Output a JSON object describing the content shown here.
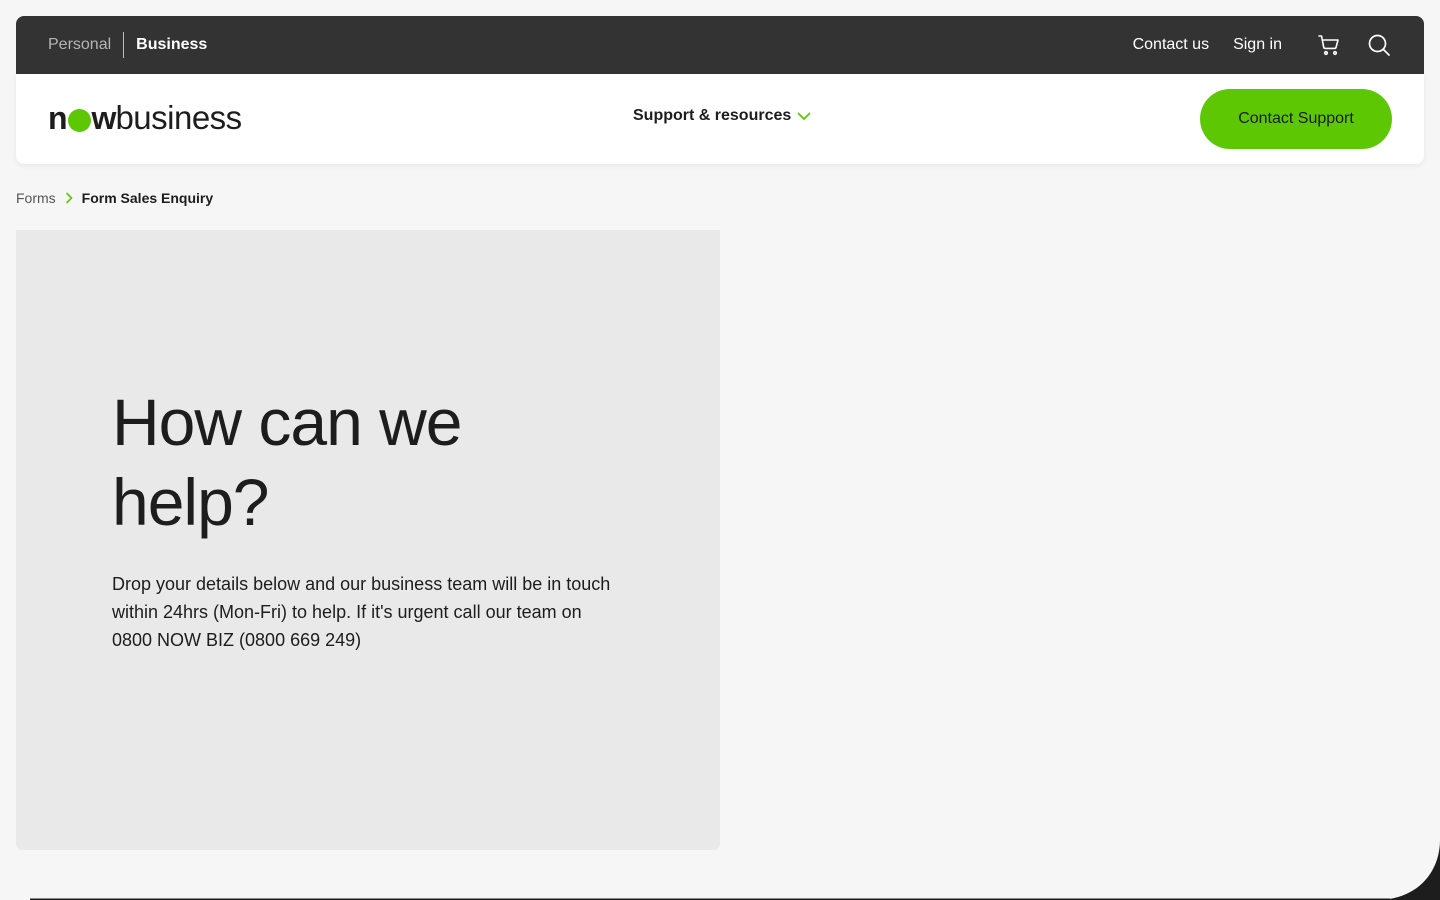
{
  "topbar": {
    "segments": {
      "personal": "Personal",
      "business": "Business"
    },
    "links": {
      "contact": "Contact us",
      "signin": "Sign in"
    },
    "icons": {
      "cart": "cart-icon",
      "search": "search-icon"
    }
  },
  "header": {
    "logo": {
      "now": "now",
      "business": "business"
    },
    "nav": {
      "support": "Support & resources"
    },
    "cta": "Contact Support"
  },
  "breadcrumb": {
    "parent": "Forms",
    "current": "Form Sales Enquiry"
  },
  "hero": {
    "title": "How can we help?",
    "description": "Drop your details below and our business team will be in touch within 24hrs (Mon-Fri) to help. If it's urgent call our team on 0800 NOW BIZ (0800 669 249)"
  },
  "colors": {
    "brand_green": "#5ec703",
    "topbar_bg": "#333333",
    "page_bg": "#f6f6f6",
    "hero_bg": "#e9e9e9"
  }
}
